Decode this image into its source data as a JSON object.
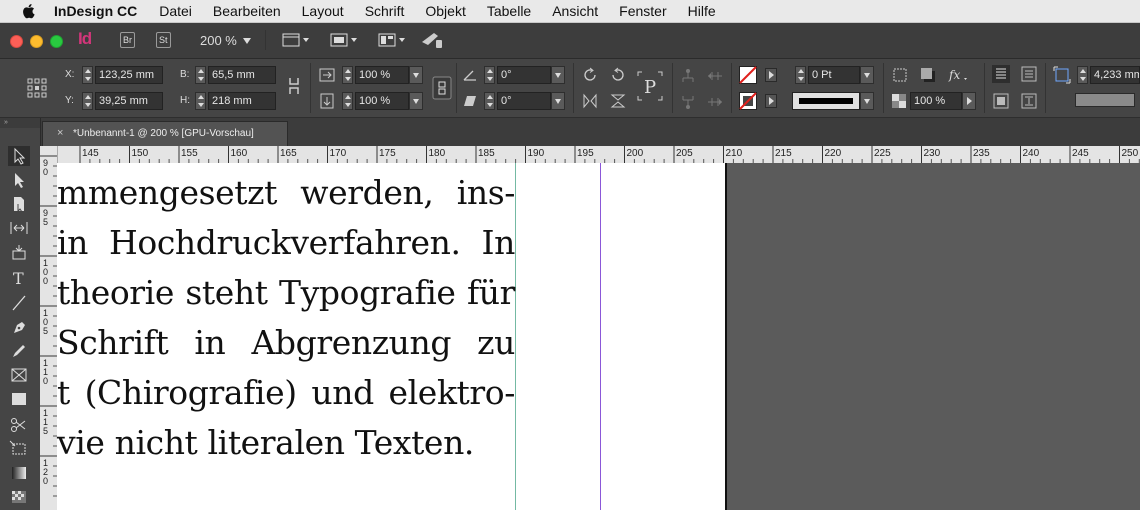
{
  "menubar": {
    "app_name": "InDesign CC",
    "items": [
      "Datei",
      "Bearbeiten",
      "Layout",
      "Schrift",
      "Objekt",
      "Tabelle",
      "Ansicht",
      "Fenster",
      "Hilfe"
    ]
  },
  "titlebar": {
    "app_logo": "Id",
    "bridge_label": "Br",
    "stock_label": "St",
    "zoom": "200 %"
  },
  "control_panel": {
    "x_label": "X:",
    "x_value": "123,25 mm",
    "y_label": "Y:",
    "y_value": "39,25 mm",
    "b_label": "B:",
    "b_value": "65,5 mm",
    "h_label": "H:",
    "h_value": "218 mm",
    "scale_x": "100 %",
    "scale_y": "100 %",
    "rotation": "0°",
    "shear": "0°",
    "stroke_weight": "0 Pt",
    "opacity": "100 %",
    "gutter": "4,233 mm"
  },
  "document_tab": {
    "close": "×",
    "title": "*Unbenannt-1 @ 200 % [GPU-Vorschau]"
  },
  "toolbox": {
    "collapse": "»"
  },
  "ruler": {
    "h_ticks": [
      "145",
      "150",
      "155",
      "160",
      "165",
      "170",
      "175",
      "180",
      "185",
      "190",
      "195",
      "200",
      "205",
      "210",
      "215",
      "220",
      "225",
      "230",
      "235",
      "240",
      "245",
      "250"
    ],
    "v_ticks": [
      "9 0",
      "9 5",
      "1 0 0",
      "1 0 5",
      "1 1 0",
      "1 1 5",
      "1 2 0"
    ]
  },
  "text_frame": {
    "lines": [
      "mmengesetzt werden, ins-",
      "in Hochdruckverfahren. In",
      "theorie steht Typografie für",
      "Schrift in Abgrenzung zu",
      "t (Chirografie) und elektro-",
      "vie nicht literalen Texten."
    ]
  },
  "colors": {
    "logo": "#d2367a",
    "margin_guide": "#74b9a3",
    "column_guide": "#8b57d8",
    "pasteboard": "#5b5b5b",
    "panel": "#454545"
  }
}
